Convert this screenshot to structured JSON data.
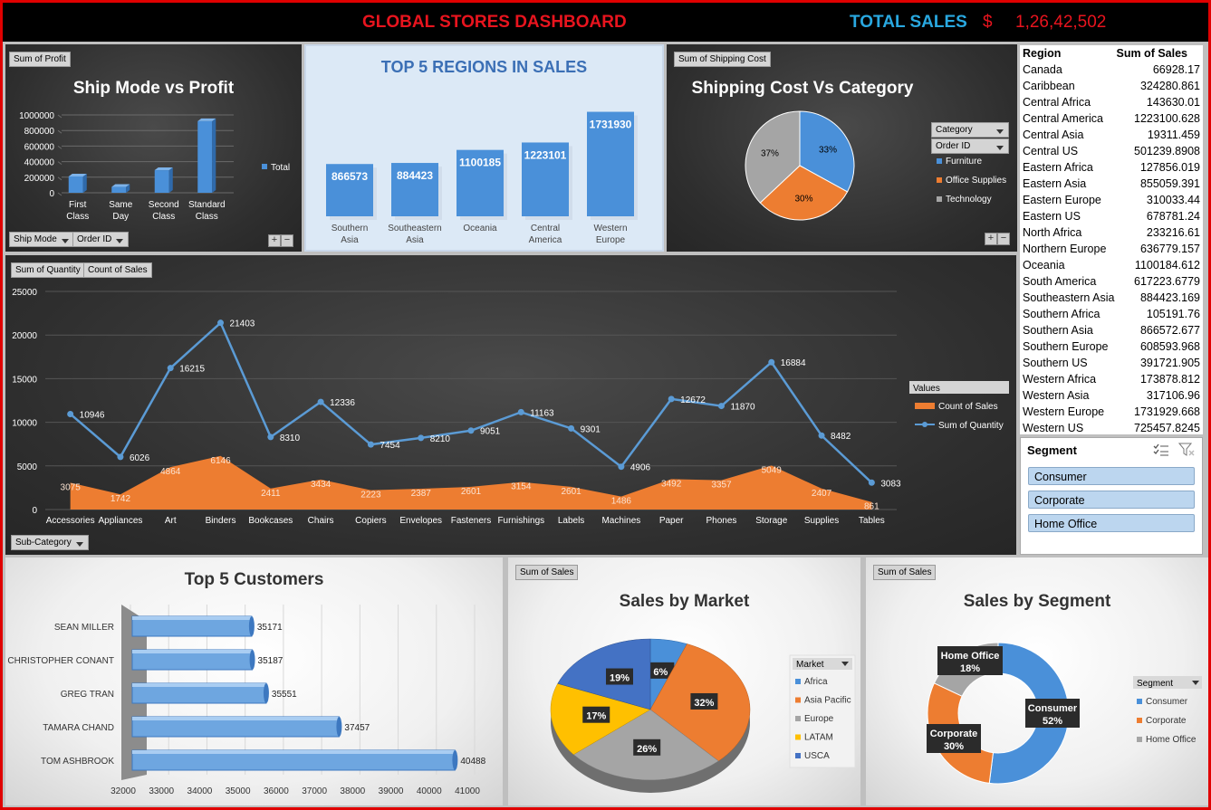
{
  "header": {
    "title": "GLOBAL STORES DASHBOARD",
    "total_label": "TOTAL SALES",
    "currency": "$",
    "total_value": "1,26,42,502"
  },
  "colors": {
    "title_red": "#e8141e",
    "total_blue": "#29a8e0",
    "bar_blue": "#4a90d9",
    "orange": "#ed7d31",
    "gray": "#a5a5a5",
    "yellow": "#ffc000",
    "dark_blue": "#4472c4"
  },
  "ship_panel": {
    "field_button": "Sum of Profit",
    "filter_ship": "Ship Mode",
    "filter_order": "Order ID",
    "plus": "+",
    "minus": "−"
  },
  "regions_panel": {},
  "shipping_panel": {
    "field_button": "Sum of Shipping Cost",
    "filter_category": "Category",
    "filter_order": "Order ID",
    "plus": "+",
    "minus": "−"
  },
  "line_panel": {
    "field_qty": "Sum of Quantity",
    "field_count": "Count of Sales",
    "filter_subcat": "Sub-Category"
  },
  "market_panel": {
    "field_button": "Sum of Sales"
  },
  "segment_panel": {
    "field_button": "Sum of Sales"
  },
  "region_table": {
    "col_region": "Region",
    "col_sales": "Sum of Sales",
    "rows": [
      {
        "region": "Canada",
        "sales": "66928.17"
      },
      {
        "region": "Caribbean",
        "sales": "324280.861"
      },
      {
        "region": "Central Africa",
        "sales": "143630.01"
      },
      {
        "region": "Central America",
        "sales": "1223100.628"
      },
      {
        "region": "Central Asia",
        "sales": "19311.459"
      },
      {
        "region": "Central US",
        "sales": "501239.8908"
      },
      {
        "region": "Eastern Africa",
        "sales": "127856.019"
      },
      {
        "region": "Eastern Asia",
        "sales": "855059.391"
      },
      {
        "region": "Eastern Europe",
        "sales": "310033.44"
      },
      {
        "region": "Eastern US",
        "sales": "678781.24"
      },
      {
        "region": "North Africa",
        "sales": "233216.61"
      },
      {
        "region": "Northern Europe",
        "sales": "636779.157"
      },
      {
        "region": "Oceania",
        "sales": "1100184.612"
      },
      {
        "region": "South America",
        "sales": "617223.6779"
      },
      {
        "region": "Southeastern Asia",
        "sales": "884423.169"
      },
      {
        "region": "Southern Africa",
        "sales": "105191.76"
      },
      {
        "region": "Southern Asia",
        "sales": "866572.677"
      },
      {
        "region": "Southern Europe",
        "sales": "608593.968"
      },
      {
        "region": "Southern US",
        "sales": "391721.905"
      },
      {
        "region": "Western Africa",
        "sales": "173878.812"
      },
      {
        "region": "Western Asia",
        "sales": "317106.96"
      },
      {
        "region": "Western Europe",
        "sales": "1731929.668"
      },
      {
        "region": "Western US",
        "sales": "725457.8245"
      }
    ]
  },
  "segment_slicer": {
    "title": "Segment",
    "items": [
      "Consumer",
      "Corporate",
      "Home Office"
    ]
  },
  "chart_data": [
    {
      "id": "ship",
      "type": "bar",
      "title": "Ship Mode vs Profit",
      "categories": [
        "First Class",
        "Same Day",
        "Second Class",
        "Standard Class"
      ],
      "series": [
        {
          "name": "Total",
          "values": [
            210000,
            75000,
            290000,
            920000
          ]
        }
      ],
      "yticks": [
        "0",
        "200000",
        "400000",
        "600000",
        "800000",
        "1000000"
      ],
      "ylim": [
        0,
        1000000
      ],
      "legend": "right"
    },
    {
      "id": "regions",
      "type": "bar",
      "title": "TOP 5 REGIONS IN SALES",
      "categories": [
        "Southern Asia",
        "Southeastern Asia",
        "Oceania",
        "Central America",
        "Western Europe"
      ],
      "values": [
        866573,
        884423,
        1100185,
        1223101,
        1731930
      ],
      "labels": [
        "866573",
        "884423",
        "1100185",
        "1223101",
        "1731930"
      ],
      "ylim": [
        0,
        1800000
      ]
    },
    {
      "id": "shipcost",
      "type": "pie",
      "title": "Shipping Cost Vs Category",
      "categories": [
        "Furniture",
        "Office Supplies",
        "Technology"
      ],
      "values": [
        33,
        30,
        37
      ],
      "labels": [
        "33%",
        "30%",
        "37%"
      ],
      "legend": "right"
    },
    {
      "id": "subcat",
      "type": "line",
      "categories": [
        "Accessories",
        "Appliances",
        "Art",
        "Binders",
        "Bookcases",
        "Chairs",
        "Copiers",
        "Envelopes",
        "Fasteners",
        "Furnishings",
        "Labels",
        "Machines",
        "Paper",
        "Phones",
        "Storage",
        "Supplies",
        "Tables"
      ],
      "series": [
        {
          "name": "Count of Sales",
          "type": "area",
          "values": [
            3075,
            1742,
            4864,
            6146,
            2411,
            3434,
            2223,
            2387,
            2601,
            3154,
            2601,
            1486,
            3492,
            3357,
            5049,
            2407,
            861
          ]
        },
        {
          "name": "Sum of Quantity",
          "type": "line",
          "values": [
            10946,
            6026,
            16215,
            21403,
            8310,
            12336,
            7454,
            8210,
            9051,
            11163,
            9301,
            4906,
            12672,
            11870,
            16884,
            8482,
            3083
          ]
        }
      ],
      "legend_title": "Values",
      "yticks": [
        "0",
        "5000",
        "10000",
        "15000",
        "20000",
        "25000"
      ],
      "ylim": [
        0,
        25000
      ]
    },
    {
      "id": "customers",
      "type": "bar",
      "orientation": "horizontal",
      "title": "Top 5 Customers",
      "categories": [
        "SEAN MILLER",
        "CHRISTOPHER CONANT",
        "GREG TRAN",
        "TAMARA CHAND",
        "TOM ASHBROOK"
      ],
      "values": [
        35171,
        35187,
        35551,
        37457,
        40488
      ],
      "labels": [
        "35171",
        "35187",
        "35551",
        "37457",
        "40488"
      ],
      "xticks": [
        "32000",
        "33000",
        "34000",
        "35000",
        "36000",
        "37000",
        "38000",
        "39000",
        "40000",
        "41000"
      ],
      "xlim": [
        32000,
        41000
      ]
    },
    {
      "id": "market",
      "type": "pie",
      "title": "Sales by Market",
      "legend_title": "Market",
      "categories": [
        "Africa",
        "Asia Pacific",
        "Europe",
        "LATAM",
        "USCA"
      ],
      "values": [
        6,
        32,
        26,
        17,
        19
      ],
      "labels": [
        "6%",
        "32%",
        "26%",
        "17%",
        "19%"
      ],
      "legend": "right"
    },
    {
      "id": "segment",
      "type": "pie",
      "title": "Sales by Segment",
      "legend_title": "Segment",
      "categories": [
        "Consumer",
        "Corporate",
        "Home Office"
      ],
      "values": [
        52,
        30,
        18
      ],
      "labels": [
        "52%",
        "30%",
        "18%"
      ],
      "legend": "right"
    }
  ]
}
